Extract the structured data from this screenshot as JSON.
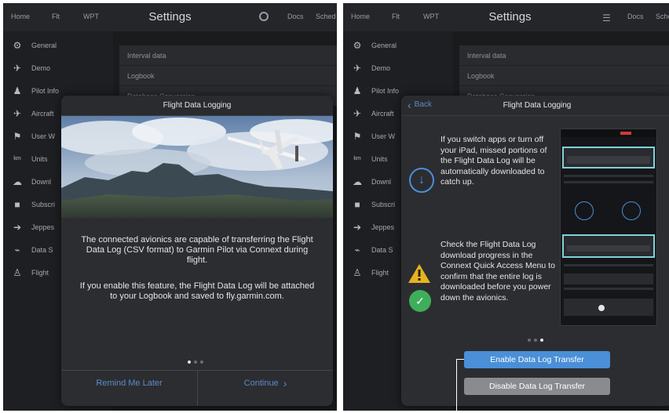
{
  "left": {
    "topbar": {
      "home": "Home",
      "flt": "Flt",
      "wpt": "WPT",
      "title": "Settings",
      "i1": "Docs",
      "i2": "Sched"
    },
    "sidebar": [
      {
        "label": "General",
        "icon": "gear-icon"
      },
      {
        "label": "Demo",
        "icon": "plane-icon"
      },
      {
        "label": "Pilot Info",
        "icon": "person-icon"
      },
      {
        "label": "Aircraft",
        "icon": "plane-icon"
      },
      {
        "label": "User W",
        "icon": "flag-icon"
      },
      {
        "label": "Units",
        "icon": "units-icon"
      },
      {
        "label": "Downl",
        "icon": "cloud-download-icon"
      },
      {
        "label": "Subscri",
        "icon": "lock-icon"
      },
      {
        "label": "Jeppes",
        "icon": "arrow-icon"
      },
      {
        "label": "Data S",
        "icon": "signal-icon"
      },
      {
        "label": "Flight",
        "icon": "pilot-icon"
      }
    ],
    "content_rows": [
      "Interval data",
      "Logbook",
      "Database Conversion"
    ],
    "modal": {
      "title": "Flight Data Logging",
      "para1": "The connected avionics are capable of transferring the Flight Data Log (CSV format) to Garmin Pilot via Connext during flight.",
      "para2": "If you enable this feature, the Flight Data Log will be attached to your Logbook and saved to fly.garmin.com.",
      "remind": "Remind Me Later",
      "continue": "Continue"
    }
  },
  "right": {
    "topbar": {
      "home": "Home",
      "flt": "Flt",
      "wpt": "WPT",
      "title": "Settings",
      "i1": "Docs",
      "i2": "Sched"
    },
    "sidebar": [
      {
        "label": "General",
        "icon": "gear-icon"
      },
      {
        "label": "Demo",
        "icon": "plane-icon"
      },
      {
        "label": "Pilot Info",
        "icon": "person-icon"
      },
      {
        "label": "Aircraft",
        "icon": "plane-icon"
      },
      {
        "label": "User W",
        "icon": "flag-icon"
      },
      {
        "label": "Units",
        "icon": "units-icon"
      },
      {
        "label": "Downl",
        "icon": "cloud-download-icon"
      },
      {
        "label": "Subscri",
        "icon": "lock-icon"
      },
      {
        "label": "Jeppes",
        "icon": "arrow-icon"
      },
      {
        "label": "Data S",
        "icon": "signal-icon"
      },
      {
        "label": "Flight",
        "icon": "pilot-icon"
      }
    ],
    "content_rows": [
      "Interval data",
      "Logbook",
      "Database Conversion"
    ],
    "modal": {
      "title": "Flight Data Logging",
      "back": "Back",
      "text1": "If you switch apps or turn off your iPad, missed portions of the Flight Data Log will be automatically downloaded to catch up.",
      "text2": "Check the Flight Data Log download progress in the Connext Quick Access Menu to confirm that the entire log is downloaded before you power down the avionics.",
      "enable": "Enable Data Log Transfer",
      "disable": "Disable Data Log Transfer"
    }
  },
  "colors": {
    "accent_blue": "#4a8fd8",
    "warning": "#e8b21f",
    "success": "#3fae5a",
    "highlight": "#7fd2d8"
  }
}
